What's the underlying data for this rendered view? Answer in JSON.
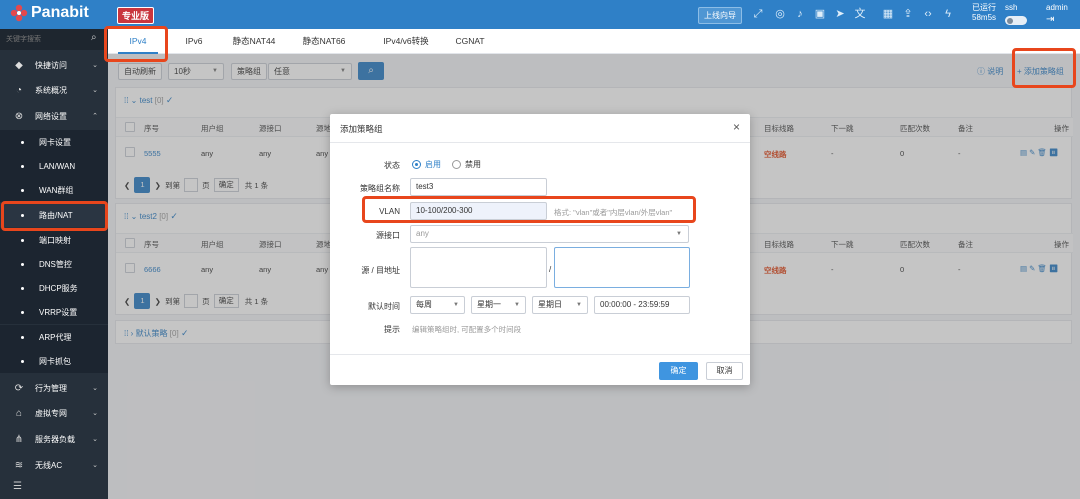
{
  "app": {
    "brand": "Panabit",
    "edition": "专业版"
  },
  "topbar": {
    "guide_label": "上线向导",
    "icons": [
      "fullscreen-icon",
      "eye-icon",
      "bell-icon",
      "book-icon",
      "send-icon",
      "translate-icon",
      "grid-icon",
      "upload-icon",
      "code-icon",
      "bolt-icon"
    ],
    "uptime_label": "已运行",
    "uptime_value": "58m5s",
    "ssh_label": "ssh",
    "user": "admin"
  },
  "sidebar": {
    "search_placeholder": "关键字搜索",
    "items": [
      {
        "label": "快捷访问",
        "icon": "diamond-icon"
      },
      {
        "label": "系统概况",
        "icon": "dashboard-icon"
      },
      {
        "label": "网络设置",
        "icon": "network-icon"
      }
    ],
    "subitems": [
      "网卡设置",
      "LAN/WAN",
      "WAN群组",
      "路由/NAT",
      "端口映射",
      "DNS管控",
      "DHCP服务",
      "VRRP设置",
      "ARP代理",
      "网卡抓包"
    ],
    "active_subitem": "路由/NAT",
    "items2": [
      {
        "label": "行为管理",
        "icon": "behavior-icon"
      },
      {
        "label": "虚拟专网",
        "icon": "vpn-icon"
      },
      {
        "label": "服务器负载",
        "icon": "server-icon"
      },
      {
        "label": "无线AC",
        "icon": "wifi-icon"
      }
    ]
  },
  "tabs": [
    "IPv4",
    "IPv6",
    "静态NAT44",
    "静态NAT66",
    "IPv4/v6转换",
    "CGNAT"
  ],
  "active_tab": "IPv4",
  "toolbar": {
    "auto_refresh": "自动刷新",
    "interval": "10秒",
    "policy_group_label": "策略组",
    "policy_group_value": "任意",
    "help": "说明",
    "add_group": "添加策略组"
  },
  "table_headers": {
    "seq": "序号",
    "usergroup": "用户组",
    "src_if": "源接口",
    "src_trunc": "源地",
    "target_line": "目标线路",
    "next_hop": "下一跳",
    "match_count": "匹配次数",
    "note": "备注",
    "ops": "操作"
  },
  "groups": [
    {
      "name": "test",
      "count": "[0]",
      "row": {
        "seq": "5555",
        "usergroup": "any",
        "src_if": "any",
        "src": "any",
        "target_line": "空线路",
        "next_hop": "-",
        "match_count": "0",
        "note": "-"
      }
    },
    {
      "name": "test2",
      "count": "[0]",
      "row": {
        "seq": "6666",
        "usergroup": "any",
        "src_if": "any",
        "src": "any",
        "target_line": "空线路",
        "next_hop": "-",
        "match_count": "0",
        "note": "-"
      }
    },
    {
      "name": "默认策略",
      "count": "[0]"
    }
  ],
  "pager": {
    "page": "1",
    "goto": "到第",
    "page_unit": "页",
    "confirm": "确定",
    "total": "共 1 条"
  },
  "modal": {
    "title": "添加策略组",
    "status_label": "状态",
    "enable": "启用",
    "disable": "禁用",
    "name_label": "策略组名称",
    "name_value": "test3",
    "vlan_label": "VLAN",
    "vlan_value": "10-100/200-300",
    "vlan_hint": "格式: \"vlan\"或者\"内层vlan/外层vlan\"",
    "src_if_label": "源接口",
    "src_if_placeholder": "any",
    "addr_label": "源 / 目地址",
    "addr_sep": "/",
    "time_label": "默认时间",
    "time_period": "每周",
    "time_from_day": "星期一",
    "time_to_day": "星期日",
    "time_range": "00:00:00 - 23:59:59",
    "tip_label": "提示",
    "tip_text": "编辑策略组时, 可配置多个时间段",
    "ok": "确定",
    "cancel": "取消"
  }
}
